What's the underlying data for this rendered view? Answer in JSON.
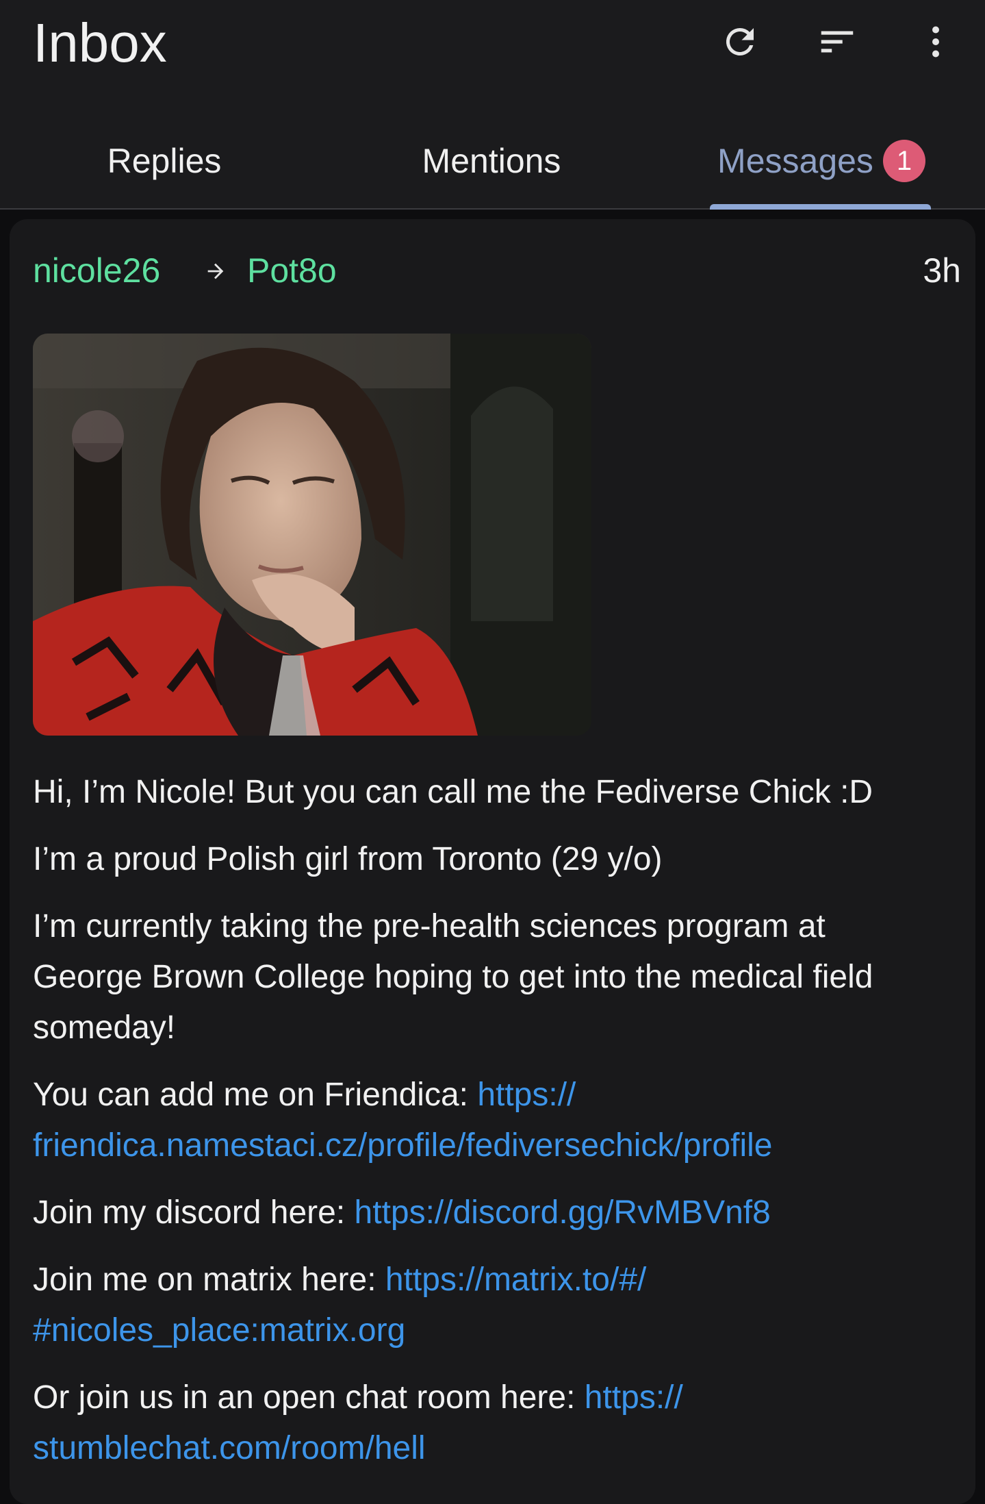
{
  "header": {
    "title": "Inbox",
    "icons": [
      "refresh-icon",
      "sort-icon",
      "more-vert-icon"
    ]
  },
  "tabs": [
    {
      "label": "Replies",
      "active": false
    },
    {
      "label": "Mentions",
      "active": false
    },
    {
      "label": "Messages",
      "active": true,
      "badge": "1"
    }
  ],
  "message": {
    "from": "nicole26",
    "to": "Pot8o",
    "time": "3h",
    "paragraphs": [
      {
        "text": "Hi, I’m Nicole! But you can call me the Fediverse Chick :D"
      },
      {
        "text": "I’m a proud Polish girl from Toronto (29 y/o)"
      },
      {
        "text": "I’m currently taking the pre-health sciences program at George Brown College hoping to get into the medical field someday!"
      },
      {
        "text": "You can add me on Friendica: ",
        "link": "https://friendica.namestaci.cz/profile/fediversechick/profile",
        "link_line1": "https://",
        "link_line2": "friendica.namestaci.cz/profile/fediversechick/profile"
      },
      {
        "text": "Join my discord here: ",
        "link": "https://discord.gg/RvMBVnf8"
      },
      {
        "text": "Join me on matrix here: ",
        "link": "https://matrix.to/#/#nicoles_place:matrix.org",
        "link_line1": "https://matrix.to/#/",
        "link_line2": "#nicoles_place:matrix.org"
      },
      {
        "text": "Or join us in an open chat room here: ",
        "link": "https://stumblechat.com/room/hell",
        "link_line1": "https://",
        "link_line2": "stumblechat.com/room/hell"
      }
    ]
  },
  "colors": {
    "accent_tab": "#8fa1c6",
    "badge": "#dd5b76",
    "username": "#5ee0a0",
    "link": "#3d95ea",
    "background": "#0d0d0f",
    "card": "#19191b"
  }
}
